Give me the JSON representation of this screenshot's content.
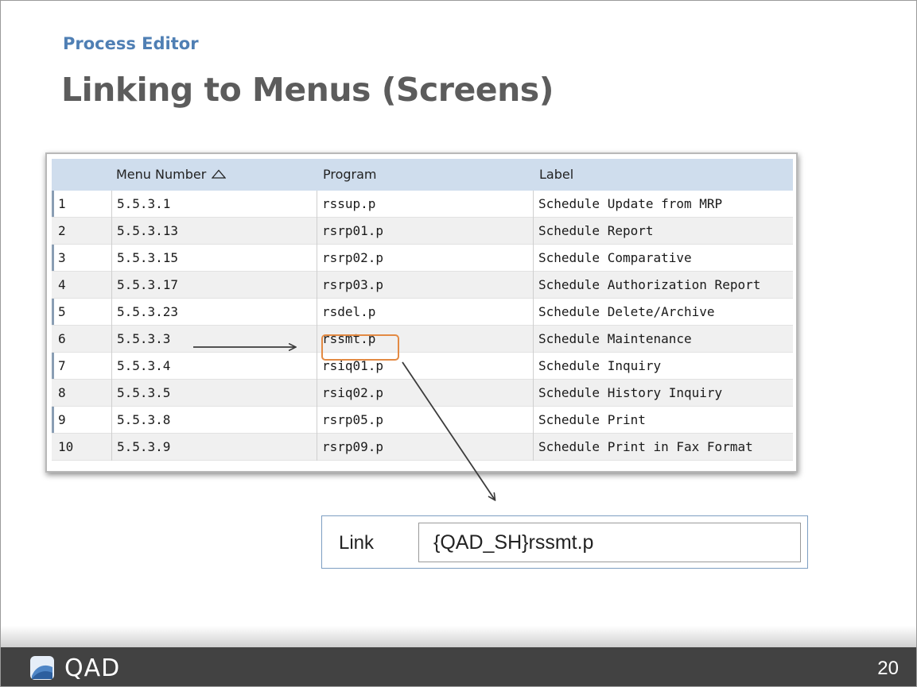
{
  "slide": {
    "subtitle": "Process Editor",
    "title": "Linking to Menus (Screens)",
    "page_number": "20"
  },
  "grid": {
    "columns": {
      "row_num": "",
      "menu_number": "Menu Number",
      "program": "Program",
      "label": "Label"
    },
    "sort_icon": "triangle-up-icon",
    "rows": [
      {
        "n": "1",
        "menu": "5.5.3.1",
        "program": "rssup.p",
        "label": "Schedule Update from MRP"
      },
      {
        "n": "2",
        "menu": "5.5.3.13",
        "program": "rsrp01.p",
        "label": "Schedule Report"
      },
      {
        "n": "3",
        "menu": "5.5.3.15",
        "program": "rsrp02.p",
        "label": "Schedule Comparative"
      },
      {
        "n": "4",
        "menu": "5.5.3.17",
        "program": "rsrp03.p",
        "label": "Schedule Authorization Report"
      },
      {
        "n": "5",
        "menu": "5.5.3.23",
        "program": "rsdel.p",
        "label": "Schedule Delete/Archive"
      },
      {
        "n": "6",
        "menu": "5.5.3.3",
        "program": "rssmt.p",
        "label": "Schedule Maintenance"
      },
      {
        "n": "7",
        "menu": "5.5.3.4",
        "program": "rsiq01.p",
        "label": "Schedule Inquiry"
      },
      {
        "n": "8",
        "menu": "5.5.3.5",
        "program": "rsiq02.p",
        "label": "Schedule History Inquiry"
      },
      {
        "n": "9",
        "menu": "5.5.3.8",
        "program": "rsrp05.p",
        "label": "Schedule Print"
      },
      {
        "n": "10",
        "menu": "5.5.3.9",
        "program": "rsrp09.p",
        "label": "Schedule Print in Fax Format"
      }
    ]
  },
  "link_field": {
    "label": "Link",
    "value": "{QAD_SH}rssmt.p"
  },
  "footer": {
    "brand": "QAD"
  },
  "colors": {
    "subtitle": "#4f7fb4",
    "title": "#5c5c5c",
    "header_bg": "#cfdded",
    "highlight": "#e38a43",
    "footer_bg": "#424242"
  }
}
